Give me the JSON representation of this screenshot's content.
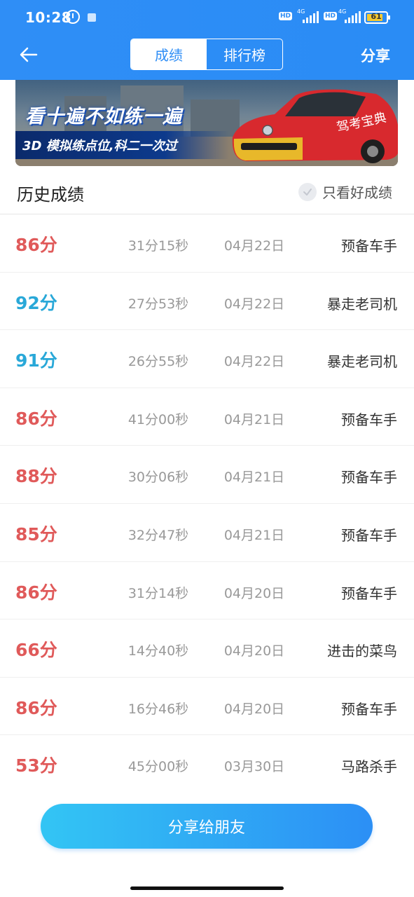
{
  "status_bar": {
    "time": "10:28",
    "network_1": "4G",
    "network_2": "4G",
    "hd": "HD",
    "battery": "61"
  },
  "header": {
    "tabs": [
      {
        "label": "成绩",
        "active": true
      },
      {
        "label": "排行榜",
        "active": false
      }
    ],
    "share_label": "分享",
    "accent": "#2f8ef6"
  },
  "banner": {
    "headline": "看十遍不如练一遍",
    "subline": "3D 模拟练点位,科二一次过",
    "car_text": "驾考宝典"
  },
  "history": {
    "title": "历史成绩",
    "filter_label": "只看好成绩"
  },
  "records": [
    {
      "score": "86分",
      "duration": "31分15秒",
      "date": "04月22日",
      "title": "预备车手",
      "color": "#e05a5a"
    },
    {
      "score": "92分",
      "duration": "27分53秒",
      "date": "04月22日",
      "title": "暴走老司机",
      "color": "#29a8d8"
    },
    {
      "score": "91分",
      "duration": "26分55秒",
      "date": "04月22日",
      "title": "暴走老司机",
      "color": "#29a8d8"
    },
    {
      "score": "86分",
      "duration": "41分00秒",
      "date": "04月21日",
      "title": "预备车手",
      "color": "#e05a5a"
    },
    {
      "score": "88分",
      "duration": "30分06秒",
      "date": "04月21日",
      "title": "预备车手",
      "color": "#e05a5a"
    },
    {
      "score": "85分",
      "duration": "32分47秒",
      "date": "04月21日",
      "title": "预备车手",
      "color": "#e05a5a"
    },
    {
      "score": "86分",
      "duration": "31分14秒",
      "date": "04月20日",
      "title": "预备车手",
      "color": "#e05a5a"
    },
    {
      "score": "66分",
      "duration": "14分40秒",
      "date": "04月20日",
      "title": "进击的菜鸟",
      "color": "#e05a5a"
    },
    {
      "score": "86分",
      "duration": "16分46秒",
      "date": "04月20日",
      "title": "预备车手",
      "color": "#e05a5a"
    },
    {
      "score": "53分",
      "duration": "45分00秒",
      "date": "03月30日",
      "title": "马路杀手",
      "color": "#e05a5a"
    }
  ],
  "footer": {
    "share_button": "分享给朋友"
  }
}
